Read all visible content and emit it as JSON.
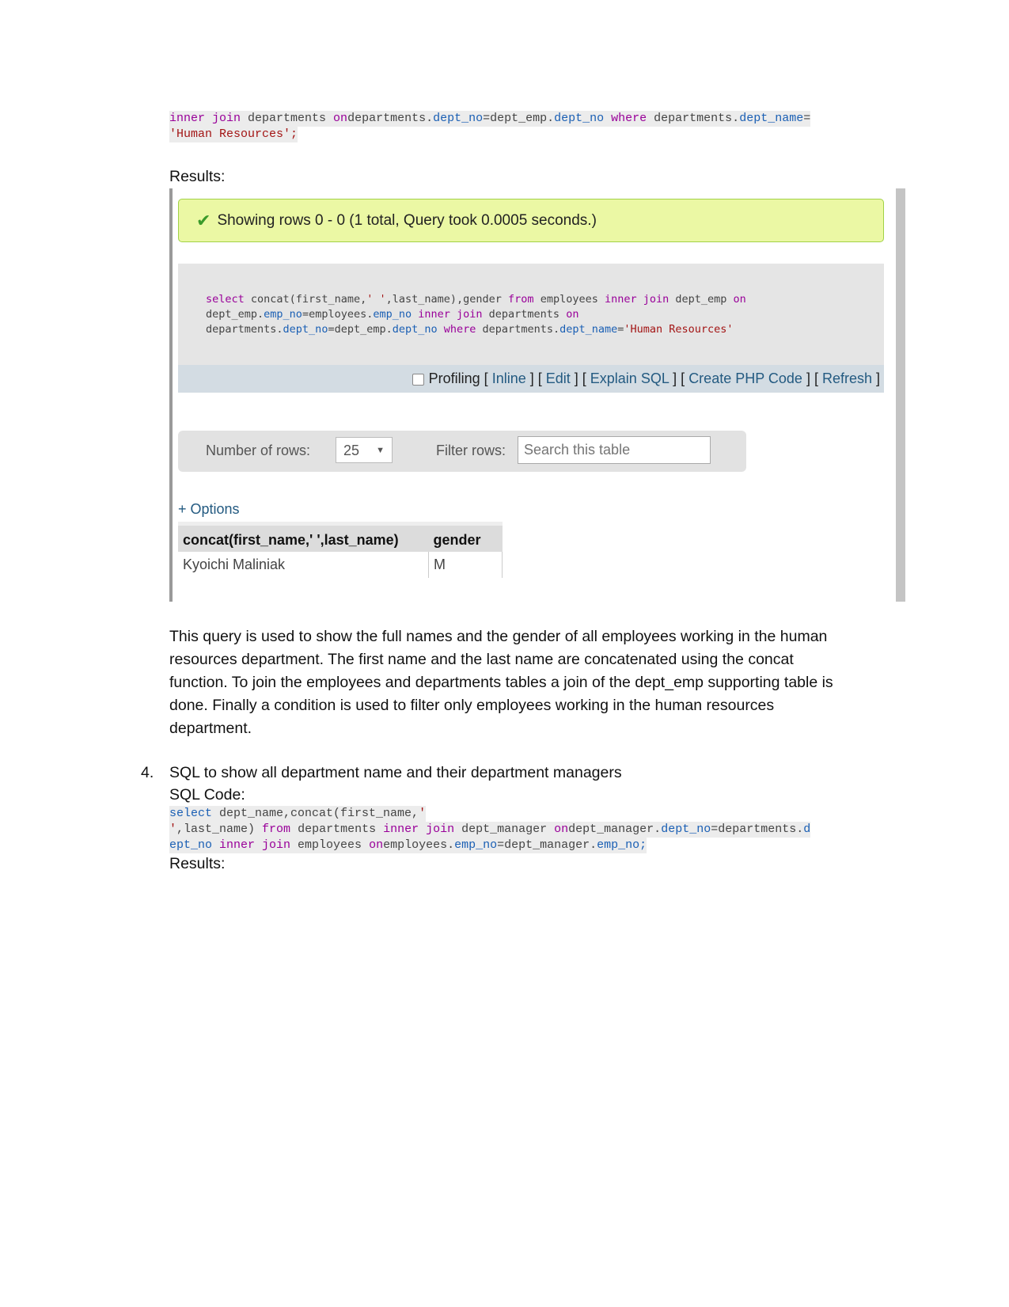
{
  "code1": [
    [
      [
        "inner join",
        "k"
      ],
      [
        " departments ",
        "p"
      ],
      [
        "on",
        "k"
      ],
      [
        "departments.",
        "p"
      ],
      [
        "dept_no",
        "b"
      ],
      [
        "=dept_emp.",
        "p"
      ],
      [
        "dept_no",
        "b"
      ],
      [
        " where",
        "k"
      ],
      [
        " departments.",
        "p"
      ],
      [
        "dept_name",
        "b"
      ],
      [
        "=",
        "p"
      ]
    ],
    [
      [
        "'Human Resources';",
        "s"
      ]
    ]
  ],
  "results_label_1": "Results:",
  "screenshot": {
    "success_message": "Showing rows 0 - 0 (1 total, Query took 0.0005 seconds.)",
    "sql": [
      [
        [
          "select",
          "k"
        ],
        [
          " concat(first_name,",
          "p"
        ],
        [
          "' '",
          "s"
        ],
        [
          ",last_name),gender ",
          "p"
        ],
        [
          "from",
          "k"
        ],
        [
          " employees ",
          "p"
        ],
        [
          "inner join",
          "k"
        ],
        [
          " dept_emp ",
          "p"
        ],
        [
          "on",
          "k"
        ]
      ],
      [
        [
          "dept_emp.",
          "p"
        ],
        [
          "emp_no",
          "b"
        ],
        [
          "=employees.",
          "p"
        ],
        [
          "emp_no",
          "b"
        ],
        [
          " inner join",
          "k"
        ],
        [
          " departments ",
          "p"
        ],
        [
          "on",
          "k"
        ]
      ],
      [
        [
          "departments.",
          "p"
        ],
        [
          "dept_no",
          "b"
        ],
        [
          "=dept_emp.",
          "p"
        ],
        [
          "dept_no",
          "b"
        ],
        [
          " where",
          "k"
        ],
        [
          " departments.",
          "p"
        ],
        [
          "dept_name",
          "b"
        ],
        [
          "=",
          "p"
        ],
        [
          "'Human Resources'",
          "s"
        ]
      ]
    ],
    "toolbar": {
      "profiling": "Profiling",
      "inline": "Inline",
      "edit": "Edit",
      "explain": "Explain SQL",
      "php": "Create PHP Code",
      "refresh": "Refresh"
    },
    "rows_label": "Number of rows:",
    "rows_value": "25",
    "filter_label": "Filter rows:",
    "filter_placeholder": "Search this table",
    "options": "+ Options",
    "columns": [
      "concat(first_name,' ',last_name)",
      "gender"
    ],
    "rows": [
      [
        "Kyoichi Maliniak",
        "M"
      ]
    ]
  },
  "paragraph": "This query is used to show the full names and the gender of all employees working in the human resources department. The first name and the last name are concatenated using the concat function. To join the employees and departments tables a join of the dept_emp supporting table is done. Finally a condition is used to filter only employees working in the human resources department.",
  "item4": {
    "number": "4.",
    "title": "SQL to show all department name and their department managers",
    "code_label": "SQL Code:",
    "results_label": "Results:"
  },
  "code2": [
    [
      [
        "select",
        "b"
      ],
      [
        " dept_name,concat(first_name,",
        "p"
      ],
      [
        "'",
        "s"
      ]
    ],
    [
      [
        "'",
        "s"
      ],
      [
        ",last_name) ",
        "p"
      ],
      [
        "from",
        "k"
      ],
      [
        " departments ",
        "p"
      ],
      [
        "inner join",
        "k"
      ],
      [
        " dept_manager ",
        "p"
      ],
      [
        "on",
        "k"
      ],
      [
        "dept_manager.",
        "p"
      ],
      [
        "dept_no",
        "b"
      ],
      [
        "=departments.",
        "p"
      ],
      [
        "d",
        "b"
      ]
    ],
    [
      [
        "ept_no",
        "b"
      ],
      [
        " inner join",
        "k"
      ],
      [
        " employees ",
        "p"
      ],
      [
        "on",
        "k"
      ],
      [
        "employees.",
        "p"
      ],
      [
        "emp_no",
        "b"
      ],
      [
        "=dept_manager.",
        "p"
      ],
      [
        "emp_no;",
        "b"
      ]
    ]
  ]
}
